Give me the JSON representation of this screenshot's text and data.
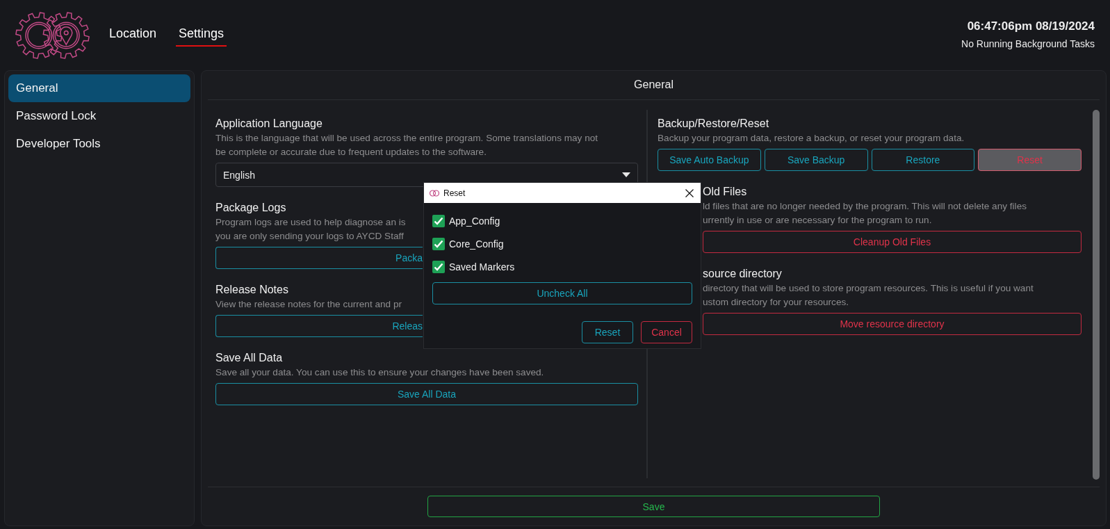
{
  "header": {
    "nav": [
      {
        "label": "Location",
        "selected": false
      },
      {
        "label": "Settings",
        "selected": true
      }
    ],
    "clock": "06:47:06pm 08/19/2024",
    "status": "No Running Background Tasks"
  },
  "sidebar": {
    "items": [
      {
        "label": "General",
        "selected": true
      },
      {
        "label": "Password Lock",
        "selected": false
      },
      {
        "label": "Developer Tools",
        "selected": false
      }
    ]
  },
  "panel": {
    "title": "General",
    "left": [
      {
        "heading": "Application Language",
        "description_lines": [
          "This is the language that will be used across the entire program. Some translations may not",
          "be complete or accurate due to frequent updates to the software."
        ],
        "kind": "select",
        "obscured": false,
        "value": "English"
      },
      {
        "heading": "Package Logs",
        "description_lines": [
          "Program logs are used to help diagnose an is",
          "you are only sending your logs to AYCD Staff"
        ],
        "kind": "button",
        "obscured": true,
        "buttons": [
          {
            "label": "Packa",
            "kind": "primary",
            "pressed": false
          }
        ]
      },
      {
        "heading": "Release Notes",
        "description_lines": [
          "View the release notes for the current and pr"
        ],
        "kind": "button",
        "obscured": true,
        "buttons": [
          {
            "label": "Releas",
            "kind": "primary",
            "pressed": false
          }
        ]
      },
      {
        "heading": "Save All Data",
        "description_lines": [
          "Save all your data. You can use this to ensure your changes have been saved."
        ],
        "kind": "button",
        "obscured": false,
        "buttons": [
          {
            "label": "Save All Data",
            "kind": "primary",
            "pressed": false
          }
        ]
      }
    ],
    "right": [
      {
        "heading": "Backup/Restore/Reset",
        "description_lines": [
          "Backup your program data, restore a backup, or reset your program data."
        ],
        "obscured": false,
        "buttons": [
          {
            "label": "Save Auto Backup",
            "kind": "primary",
            "pressed": false
          },
          {
            "label": "Save Backup",
            "kind": "primary",
            "pressed": false
          },
          {
            "label": "Restore",
            "kind": "primary",
            "pressed": false
          },
          {
            "label": "Reset",
            "kind": "danger",
            "pressed": true
          }
        ]
      },
      {
        "heading": "Old Files",
        "description_lines": [
          "ld files that are no longer needed by the program. This will not delete any files",
          "urrently in use or are necessary for the program to run."
        ],
        "obscured": true,
        "buttons": [
          {
            "label": "Cleanup Old Files",
            "kind": "danger",
            "pressed": false
          }
        ]
      },
      {
        "heading": "source directory",
        "description_lines": [
          "directory that will be used to store program resources. This is useful if you want",
          "ustom directory for your resources."
        ],
        "obscured": true,
        "buttons": [
          {
            "label": "Move resource directory",
            "kind": "danger",
            "pressed": false
          }
        ]
      }
    ],
    "save": "Save"
  },
  "dialog": {
    "title": "Reset",
    "options": [
      {
        "label": "App_Config",
        "checked": true
      },
      {
        "label": "Core_Config",
        "checked": true
      },
      {
        "label": "Saved Markers",
        "checked": true
      }
    ],
    "uncheck_all": "Uncheck All",
    "buttons": [
      {
        "label": "Reset",
        "kind": "primary"
      },
      {
        "label": "Cancel",
        "kind": "danger"
      }
    ]
  }
}
